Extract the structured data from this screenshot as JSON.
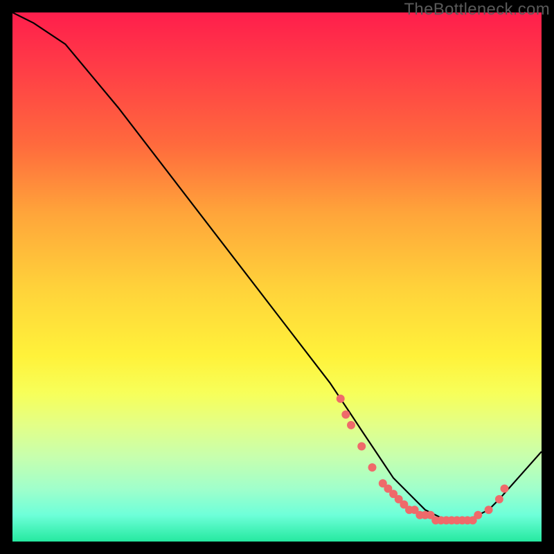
{
  "watermark": "TheBottleneck.com",
  "chart_data": {
    "type": "line",
    "title": "",
    "xlabel": "",
    "ylabel": "",
    "xlim": [
      0,
      100
    ],
    "ylim": [
      0,
      100
    ],
    "grid": false,
    "legend": false,
    "series": [
      {
        "name": "curve",
        "x": [
          0,
          4,
          10,
          20,
          30,
          40,
          50,
          60,
          64,
          66,
          68,
          70,
          72,
          74,
          76,
          78,
          80,
          82,
          84,
          86,
          88,
          90,
          92,
          100
        ],
        "y": [
          100,
          98,
          94,
          82,
          69,
          56,
          43,
          30,
          24,
          21,
          18,
          15,
          12,
          10,
          8,
          6,
          5,
          4,
          4,
          4,
          5,
          6,
          8,
          17
        ],
        "color": "#000000",
        "width": 2.2
      }
    ],
    "markers": {
      "name": "dots",
      "x": [
        62,
        63,
        64,
        66,
        68,
        70,
        71,
        72,
        73,
        74,
        75,
        76,
        77,
        78,
        79,
        80,
        81,
        82,
        83,
        84,
        85,
        86,
        87,
        88,
        90,
        92,
        93
      ],
      "y": [
        27,
        24,
        22,
        18,
        14,
        11,
        10,
        9,
        8,
        7,
        6,
        6,
        5,
        5,
        5,
        4,
        4,
        4,
        4,
        4,
        4,
        4,
        4,
        5,
        6,
        8,
        10
      ],
      "color": "#ef6a6a",
      "radius": 6
    }
  }
}
